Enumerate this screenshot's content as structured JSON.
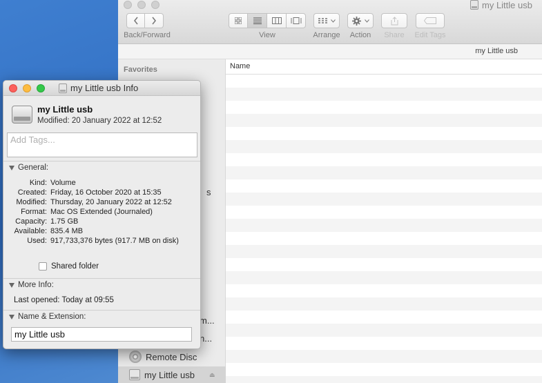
{
  "finder": {
    "window_title": "my Little usb",
    "toolbar": {
      "back_forward_label": "Back/Forward",
      "view_label": "View",
      "arrange_label": "Arrange",
      "action_label": "Action",
      "share_label": "Share",
      "edit_tags_label": "Edit Tags"
    },
    "path_label": "my Little usb",
    "sidebar": {
      "favorites_heading": "Favorites",
      "partial_s": "s",
      "partial_m": "m...",
      "partial_n": "n...",
      "remote_disc": "Remote Disc",
      "selected_volume": "my Little usb"
    },
    "list": {
      "name_column": "Name"
    }
  },
  "info_panel": {
    "title": "my Little usb Info",
    "volume_name": "my Little usb",
    "modified_summary": "Modified: 20 January 2022 at 12:52",
    "tags_placeholder": "Add Tags...",
    "general": {
      "heading": "General:",
      "rows": [
        {
          "key": "Kind:",
          "value": "Volume"
        },
        {
          "key": "Created:",
          "value": "Friday, 16 October 2020 at 15:35"
        },
        {
          "key": "Modified:",
          "value": "Thursday, 20 January 2022 at 12:52"
        },
        {
          "key": "Format:",
          "value": "Mac OS Extended (Journaled)"
        },
        {
          "key": "Capacity:",
          "value": "1.75 GB"
        },
        {
          "key": "Available:",
          "value": "835.4 MB"
        },
        {
          "key": "Used:",
          "value": "917,733,376 bytes (917.7 MB on disk)"
        }
      ],
      "shared_folder_label": "Shared folder"
    },
    "more_info": {
      "heading": "More Info:",
      "last_opened": "Last opened: Today at 09:55"
    },
    "name_extension": {
      "heading": "Name & Extension:",
      "name_value": "my Little usb"
    }
  }
}
